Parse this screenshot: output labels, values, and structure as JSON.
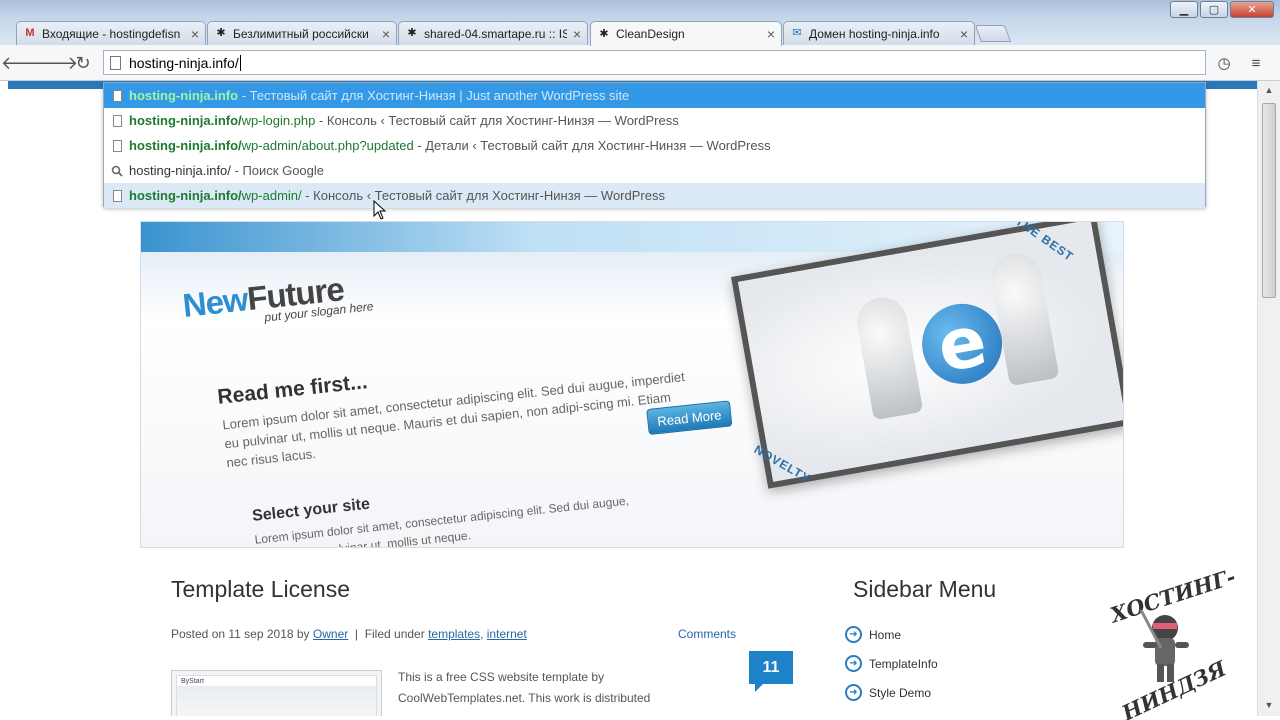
{
  "browser": {
    "tabs": [
      {
        "label": "Входящие - hostingdefisn",
        "icon": "gmail-icon",
        "icon_glyph": "M",
        "icon_color": "#c5362b"
      },
      {
        "label": "Безлимитный российски",
        "icon": "ninja-favicon",
        "icon_glyph": "✱",
        "icon_color": "#333333"
      },
      {
        "label": "shared-04.smartape.ru :: IS",
        "icon": "ninja-favicon",
        "icon_glyph": "✱",
        "icon_color": "#333333"
      },
      {
        "label": "CleanDesign",
        "icon": "ninja-favicon",
        "icon_glyph": "✱",
        "icon_color": "#333333",
        "active": true
      },
      {
        "label": "Домен hosting-ninja.info",
        "icon": "mail-icon",
        "icon_glyph": "✉",
        "icon_color": "#2a6fb8"
      }
    ],
    "address": "hosting-ninja.info/",
    "suggestions": [
      {
        "url_bold": "hosting-ninja.info",
        "url_rest": "",
        "desc": " - Тестовый сайт для Хостинг-Нинзя | Just another WordPress site",
        "type": "page",
        "state": "selected"
      },
      {
        "url_bold": "hosting-ninja.info/",
        "url_rest": "wp-login.php",
        "desc": " - Консоль ‹ Тестовый сайт для Хостинг-Нинзя — WordPress",
        "type": "page",
        "state": ""
      },
      {
        "url_bold": "hosting-ninja.info/",
        "url_rest": "wp-admin/about.php?updated",
        "desc": " - Детали ‹ Тестовый сайт для Хостинг-Нинзя — WordPress",
        "type": "page",
        "state": ""
      },
      {
        "url_bold": "",
        "url_rest": "",
        "plain": "hosting-ninja.info/",
        "desc": " - Поиск Google",
        "type": "search",
        "state": ""
      },
      {
        "url_bold": "hosting-ninja.info/",
        "url_rest": "wp-admin/",
        "desc": " - Консоль ‹ Тестовый сайт для Хостинг-Нинзя — WordPress",
        "type": "page",
        "state": "hover"
      }
    ]
  },
  "banner": {
    "logo_new": "New",
    "logo_future": "Future",
    "slogan": "put your slogan here",
    "heading": "Read me first...",
    "lorem1": "Lorem ipsum dolor sit amet, consectetur adipiscing elit. Sed dui augue, imperdiet eu pulvinar ut, mollis ut neque. Mauris et dui sapien, non adipi-scing mi. Etiam nec risus lacus.",
    "read_more": "Read More",
    "select_heading": "Select your site",
    "lorem2": "Lorem ipsum dolor sit amet, consectetur adipiscing elit. Sed dui augue, imperdiet eu pulvinar ut, mollis ut neque.",
    "ribbon_best": "THE BEST",
    "ribbon_novelty": "NOVELTY"
  },
  "post": {
    "title": "Template License",
    "posted_prefix": "Posted on 11 sep 2018 by ",
    "author": "Owner",
    "filed_prefix": "  |  Filed under ",
    "tag1": "templates",
    "tag_sep": ", ",
    "tag2": "internet",
    "comments_label": "Comments",
    "comment_count": "11",
    "thumb_text": "ByStart",
    "text": "This is a free CSS website template by CoolWebTemplates.net. This work is distributed"
  },
  "sidebar": {
    "title": "Sidebar Menu",
    "items": [
      {
        "label": "Home"
      },
      {
        "label": "TemplateInfo"
      },
      {
        "label": "Style Demo"
      }
    ]
  },
  "watermark": {
    "line1": "ХОСТИНГ-",
    "line2": "НИНДЗЯ"
  },
  "colors": {
    "accent": "#2a77b9",
    "selection": "#3399e6",
    "url_green": "#1e7a2f"
  }
}
